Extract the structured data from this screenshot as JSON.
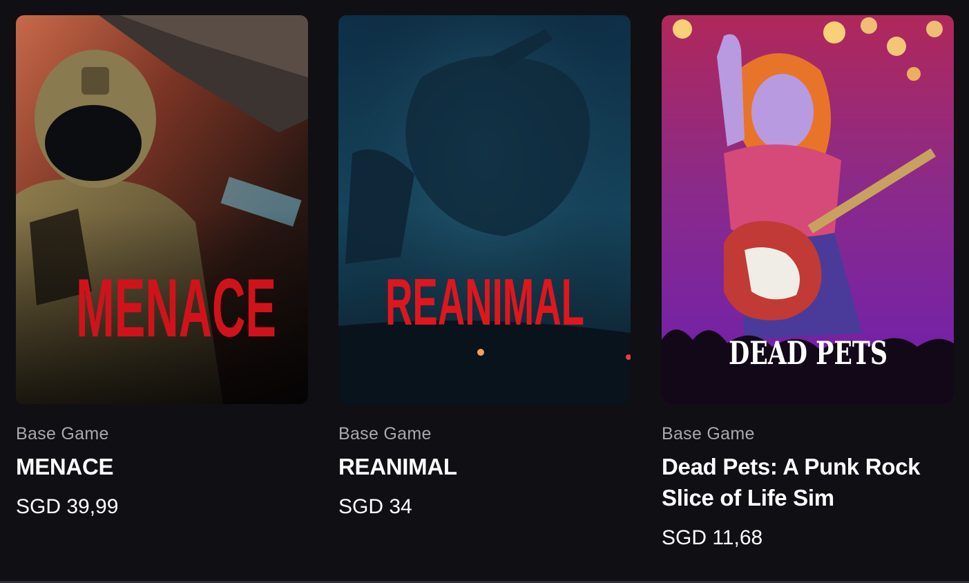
{
  "products": [
    {
      "type": "Base Game",
      "title": "MENACE",
      "price": "SGD 39,99",
      "art_logo": "MENACE",
      "art_logo_color": "#d0121b"
    },
    {
      "type": "Base Game",
      "title": "REANIMAL",
      "price": "SGD 34",
      "art_logo": "REANIMAL",
      "art_logo_color": "#e0161d"
    },
    {
      "type": "Base Game",
      "title": "Dead Pets: A Punk Rock Slice of Life Sim",
      "price": "SGD 11,68",
      "art_logo": "DEAD PETS",
      "art_logo_color": "#ffffff"
    }
  ],
  "colors": {
    "background": "#101014",
    "muted_text": "#a8a8ad",
    "text": "#ffffff"
  }
}
